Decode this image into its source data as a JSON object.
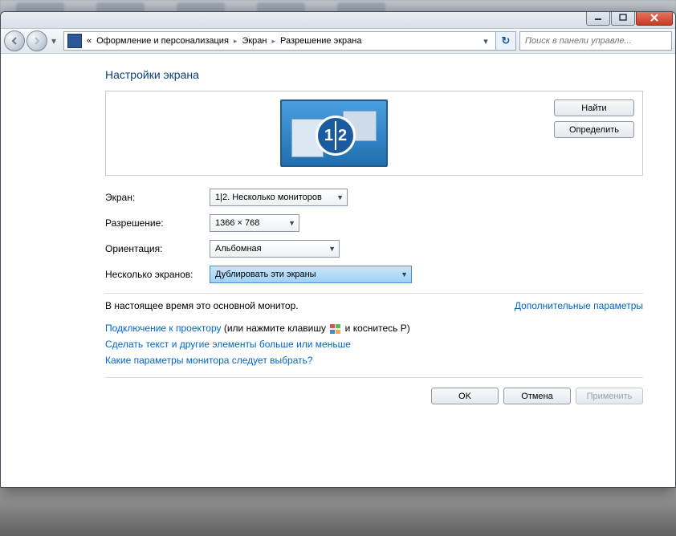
{
  "breadcrumb": {
    "prefix": "«",
    "seg1": "Оформление и персонализация",
    "seg2": "Экран",
    "seg3": "Разрешение экрана"
  },
  "search": {
    "placeholder": "Поиск в панели управле..."
  },
  "heading": "Настройки экрана",
  "buttons": {
    "find": "Найти",
    "identify": "Определить",
    "ok": "OK",
    "cancel": "Отмена",
    "apply": "Применить"
  },
  "monitor_label": {
    "n1": "1",
    "n2": "2"
  },
  "labels": {
    "screen": "Экран:",
    "resolution": "Разрешение:",
    "orientation": "Ориентация:",
    "multiple": "Несколько экранов:"
  },
  "values": {
    "screen": "1|2. Несколько мониторов",
    "resolution": "1366 × 768",
    "orientation": "Альбомная",
    "multiple": "Дублировать эти экраны"
  },
  "status": {
    "primary": "В настоящее время это основной монитор.",
    "advanced": "Дополнительные параметры"
  },
  "links": {
    "projector_link": "Подключение к проектору",
    "projector_tail1": " (или нажмите клавишу ",
    "projector_tail2": " и коснитесь P)",
    "textsize": "Сделать текст и другие элементы больше или меньше",
    "whichparams": "Какие параметры монитора следует выбрать?"
  }
}
